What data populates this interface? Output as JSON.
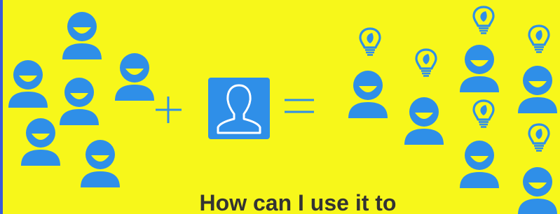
{
  "caption": {
    "text": "How can I use it to"
  },
  "icons": {
    "crowd_person": "user-icon",
    "operator_plus": "plus-icon",
    "profile_card": "profile-placeholder-icon",
    "operator_equals": "equals-icon",
    "idea_bulb": "lightbulb-leaf-icon"
  },
  "colors": {
    "background": "#f7f71a",
    "icon_blue": "#2f8fe8",
    "mouth_yellow": "#f7f71a",
    "text": "#333333",
    "left_border": "#3a5bd9"
  }
}
